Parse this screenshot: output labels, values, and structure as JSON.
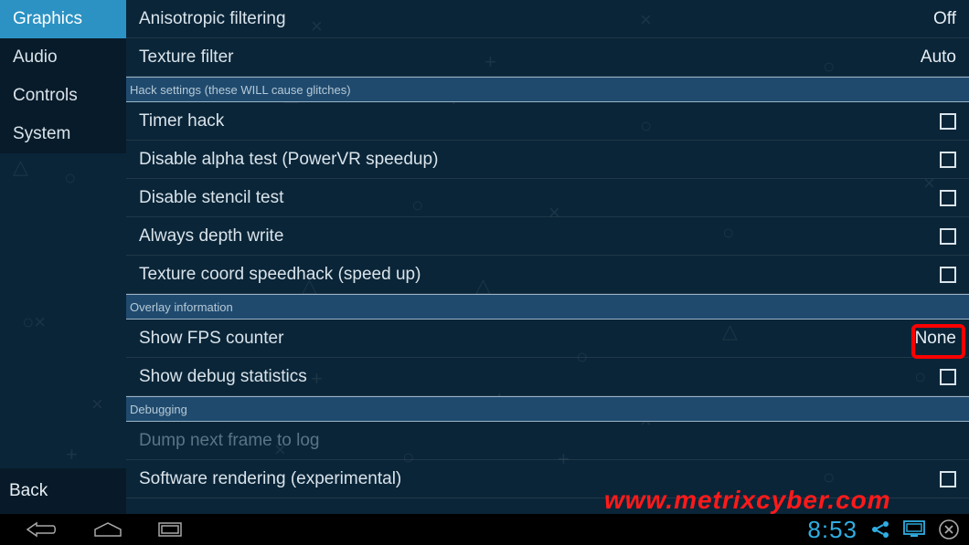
{
  "sidebar": {
    "items": [
      {
        "label": "Graphics",
        "active": true
      },
      {
        "label": "Audio",
        "active": false
      },
      {
        "label": "Controls",
        "active": false
      },
      {
        "label": "System",
        "active": false
      }
    ],
    "back_label": "Back"
  },
  "sections": {
    "top_rows": [
      {
        "label": "Anisotropic filtering",
        "value": "Off",
        "type": "value"
      },
      {
        "label": "Texture filter",
        "value": "Auto",
        "type": "value"
      }
    ],
    "hack_header": "Hack settings (these WILL cause glitches)",
    "hack_rows": [
      {
        "label": "Timer hack",
        "type": "check"
      },
      {
        "label": "Disable alpha test (PowerVR speedup)",
        "type": "check"
      },
      {
        "label": "Disable stencil test",
        "type": "check"
      },
      {
        "label": "Always depth write",
        "type": "check"
      },
      {
        "label": "Texture coord speedhack (speed up)",
        "type": "check"
      }
    ],
    "overlay_header": "Overlay information",
    "overlay_rows": [
      {
        "label": "Show FPS counter",
        "value": "None",
        "type": "value",
        "highlight": true
      },
      {
        "label": "Show debug statistics",
        "type": "check"
      }
    ],
    "debug_header": "Debugging",
    "debug_rows": [
      {
        "label": "Dump next frame to log",
        "type": "disabled"
      },
      {
        "label": "Software rendering (experimental)",
        "type": "check"
      }
    ]
  },
  "watermark": "www.metrixcyber.com",
  "statusbar": {
    "clock": "8:53"
  }
}
